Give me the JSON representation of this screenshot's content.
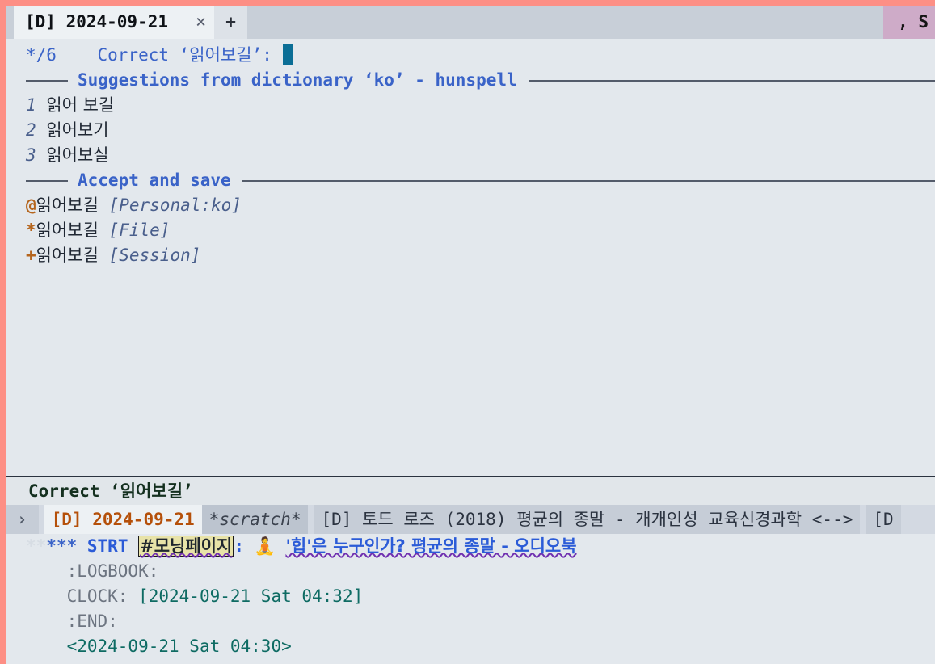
{
  "window": {
    "frame_border_color": "#fd8f85",
    "background": "#e3e8ed"
  },
  "tabbar": {
    "tabs": [
      {
        "label": "[D] 2024-09-21",
        "close": "×",
        "state": "active"
      }
    ],
    "new_tab_label": "+",
    "trailing_tab_label": ", S"
  },
  "popup": {
    "prompt_counter": "*/6",
    "prompt_text": "Correct ‘읽어보길’:",
    "input_value": "",
    "sections": [
      {
        "title": "Suggestions from dictionary ‘ko’ - hunspell"
      },
      {
        "title": "Accept and save"
      }
    ],
    "suggestions": [
      {
        "key": "1",
        "text": "읽어 보길"
      },
      {
        "key": "2",
        "text": "읽어보기"
      },
      {
        "key": "3",
        "text": "읽어보실"
      }
    ],
    "accept_actions": [
      {
        "key": "@",
        "text": "읽어보길",
        "scope": "[Personal:ko]"
      },
      {
        "key": "*",
        "text": "읽어보길",
        "scope": "[File]"
      },
      {
        "key": "+",
        "text": "읽어보길",
        "scope": "[Session]"
      }
    ]
  },
  "modeline": {
    "text": "Correct ‘읽어보길’"
  },
  "buffer_tabs": {
    "chevron": "›",
    "items": [
      {
        "label": "[D] 2024-09-21",
        "state": "current"
      },
      {
        "label": "*scratch*",
        "state": "scratch"
      },
      {
        "label": "[D] 토드 로즈 (2018) 평균의 종말 - 개개인성 교육신경과학 <-->",
        "state": "other"
      },
      {
        "label": "[D",
        "state": "other"
      }
    ]
  },
  "org_buffer": {
    "lines": [
      {
        "type": "headline",
        "stars_hidden": "**",
        "stars": "***",
        "todo": "STRT",
        "highlight_word": "#모닝페이지",
        "after_word": ":",
        "emoji": "🧘",
        "rest": "'힙'은 누구인가? 평균의 종말 - 오디오북"
      },
      {
        "type": "drawer",
        "text": ":LOGBOOK:"
      },
      {
        "type": "clock",
        "label": "CLOCK: ",
        "stamp": "[2024-09-21 Sat 04:32]"
      },
      {
        "type": "drawer",
        "text": ":END:"
      },
      {
        "type": "timestamp",
        "stamp": "<2024-09-21 Sat 04:30>"
      }
    ]
  }
}
